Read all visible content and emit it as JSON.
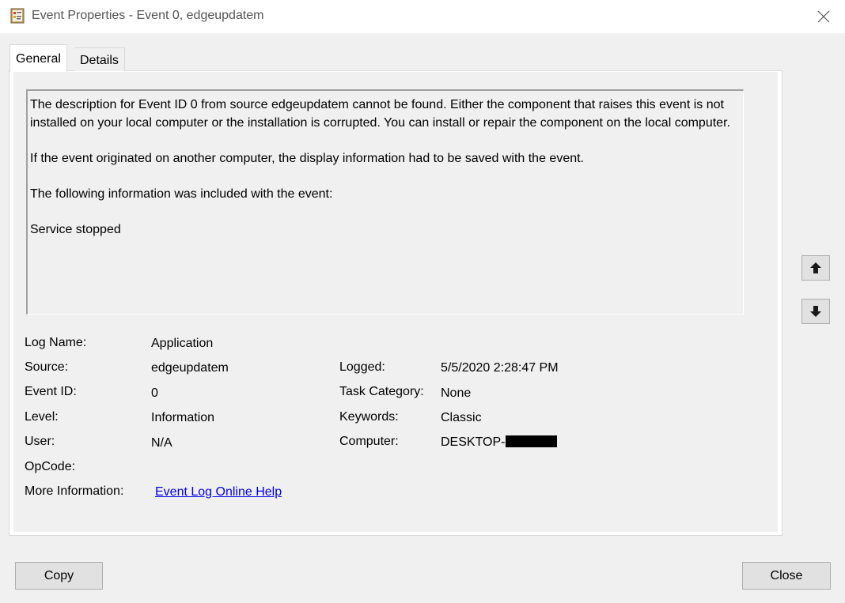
{
  "window": {
    "title": "Event Properties - Event 0, edgeupdatem"
  },
  "tabs": [
    {
      "label": "General",
      "active": true
    },
    {
      "label": "Details",
      "active": false
    }
  ],
  "description": {
    "paragraphs": [
      "The description for Event ID 0 from source edgeupdatem cannot be found. Either the component that raises this event is not installed on your local computer or the installation is corrupted. You can install or repair the component on the local computer.",
      "If the event originated on another computer, the display information had to be saved with the event.",
      "The following information was included with the event:",
      "Service stopped"
    ]
  },
  "fields": {
    "log_name": {
      "label": "Log Name:",
      "value": "Application"
    },
    "source": {
      "label": "Source:",
      "value": "edgeupdatem"
    },
    "event_id": {
      "label": "Event ID:",
      "value": "0"
    },
    "level": {
      "label": "Level:",
      "value": "Information"
    },
    "user": {
      "label": "User:",
      "value": "N/A"
    },
    "opcode": {
      "label": "OpCode:",
      "value": ""
    },
    "more_info": {
      "label": "More Information:",
      "value": "Event Log Online Help"
    },
    "logged": {
      "label": "Logged:",
      "value": "5/5/2020 2:28:47 PM"
    },
    "task_category": {
      "label": "Task Category:",
      "value": "None"
    },
    "keywords": {
      "label": "Keywords:",
      "value": "Classic"
    },
    "computer": {
      "label": "Computer:",
      "value": "DESKTOP-"
    }
  },
  "nav": {
    "up_icon": "arrow-up-icon",
    "down_icon": "arrow-down-icon"
  },
  "buttons": {
    "copy": "Copy",
    "close": "Close"
  },
  "colors": {
    "link": "#0000ee",
    "dialog_background": "#f0f0f0",
    "button_face": "#e1e1e1"
  }
}
